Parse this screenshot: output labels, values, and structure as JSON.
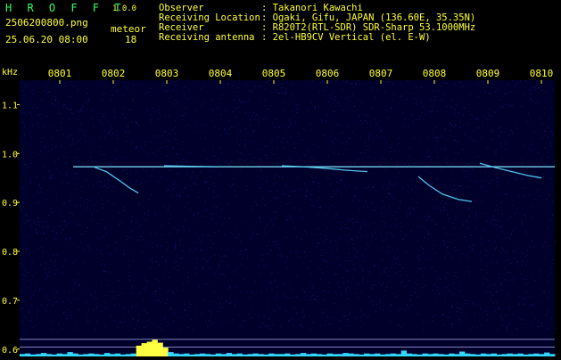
{
  "app": {
    "title": "H R O F F T",
    "version": "1.0.0"
  },
  "file": {
    "name": "2506200800.png",
    "datetime": "25.06.20 08:00"
  },
  "meteor": {
    "label": "meteor",
    "count": "18"
  },
  "info": [
    {
      "label": "Observer",
      "value": ": Takanori Kawachi"
    },
    {
      "label": "Receiving Location",
      "value": ": Ogaki, Gifu, JAPAN (136.60E, 35.35N)"
    },
    {
      "label": "Receiver",
      "value": ": R820T2(RTL-SDR) SDR-Sharp 53.1000MHz"
    },
    {
      "label": "Receiving antenna",
      "value": ": 2el-HB9CV Vertical (el. E-W)"
    }
  ],
  "chart_data": {
    "type": "heatmap",
    "title": "",
    "xlabel": "",
    "ylabel": "kHz",
    "x_ticks": [
      "0801",
      "0802",
      "0803",
      "0804",
      "0805",
      "0806",
      "0807",
      "0808",
      "0809",
      "0810"
    ],
    "y_ticks": [
      "1.1",
      "1.0",
      "0.9",
      "0.8",
      "0.7",
      "0.6"
    ],
    "ylim": [
      0.585,
      1.15
    ],
    "xlim": [
      0,
      10
    ],
    "carrier_khz": 0.973,
    "grid": false,
    "colors": {
      "background": "#00002a",
      "noise": "#1e2ba8",
      "signal": "#5ad8ff",
      "hot": "#ffff44",
      "baseline": "#33d7ff"
    },
    "meteor_traces": [
      {
        "name": "trace-1",
        "points": [
          [
            1.4,
            0.972
          ],
          [
            1.62,
            0.963
          ],
          [
            1.85,
            0.946
          ],
          [
            2.05,
            0.93
          ],
          [
            2.22,
            0.919
          ]
        ]
      },
      {
        "name": "trace-2",
        "points": [
          [
            2.7,
            0.975
          ],
          [
            3.2,
            0.974
          ],
          [
            3.7,
            0.973
          ]
        ]
      },
      {
        "name": "trace-3",
        "points": [
          [
            4.9,
            0.975
          ],
          [
            5.3,
            0.973
          ],
          [
            5.7,
            0.97
          ],
          [
            6.1,
            0.966
          ],
          [
            6.5,
            0.963
          ]
        ]
      },
      {
        "name": "trace-4",
        "points": [
          [
            7.45,
            0.953
          ],
          [
            7.65,
            0.935
          ],
          [
            7.9,
            0.917
          ],
          [
            8.2,
            0.906
          ],
          [
            8.45,
            0.902
          ]
        ]
      },
      {
        "name": "trace-5",
        "points": [
          [
            8.6,
            0.98
          ],
          [
            8.9,
            0.971
          ],
          [
            9.2,
            0.963
          ],
          [
            9.5,
            0.955
          ],
          [
            9.75,
            0.95
          ]
        ]
      }
    ],
    "activity": [
      5,
      6,
      4,
      5,
      7,
      5,
      4,
      6,
      5,
      9,
      6,
      4,
      5,
      6,
      5,
      4,
      7,
      5,
      6,
      4,
      5,
      6,
      22,
      27,
      30,
      34,
      28,
      18,
      9,
      6,
      5,
      6,
      4,
      5,
      6,
      5,
      4,
      6,
      5,
      7,
      5,
      6,
      4,
      5,
      6,
      5,
      4,
      6,
      5,
      5,
      6,
      4,
      5,
      7,
      5,
      6,
      5,
      4,
      6,
      5,
      5,
      7,
      6,
      5,
      4,
      6,
      5,
      6,
      4,
      5,
      6,
      5,
      12,
      6,
      5,
      4,
      6,
      5,
      6,
      5,
      4,
      6,
      5,
      10,
      6,
      5,
      4,
      6,
      5,
      6,
      4,
      5,
      6,
      5,
      6,
      4,
      5,
      6,
      5,
      8,
      5
    ]
  }
}
